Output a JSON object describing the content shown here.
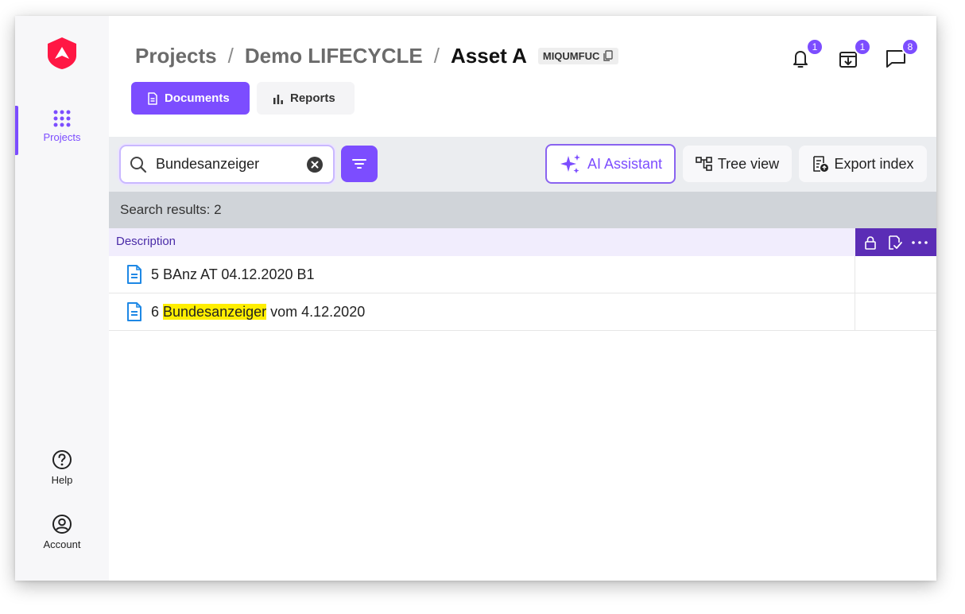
{
  "sidebar": {
    "items": [
      {
        "label": "Projects",
        "icon": "grid-icon",
        "active": true
      },
      {
        "label": "Help",
        "icon": "help-icon"
      },
      {
        "label": "Account",
        "icon": "account-icon"
      }
    ]
  },
  "breadcrumb": {
    "items": [
      "Projects",
      "Demo LIFECYCLE"
    ],
    "current": "Asset A",
    "separator": "/",
    "code": "MIQUMFUC"
  },
  "notifications": {
    "bell_count": "1",
    "inbox_count": "1",
    "chat_count": "8"
  },
  "tabs": [
    {
      "label": "Documents",
      "active": true
    },
    {
      "label": "Reports",
      "active": false
    }
  ],
  "toolbar": {
    "search_value": "Bundesanzeiger",
    "ai_label": "AI Assistant",
    "tree_label": "Tree view",
    "export_label": "Export index"
  },
  "results": {
    "summary": "Search results: 2"
  },
  "table": {
    "column_description": "Description",
    "rows": [
      {
        "text": "5 BAnz AT 04.12.2020 B1"
      },
      {
        "prefix": "6 ",
        "highlight": "Bundesanzeiger",
        "suffix": " vom 4.12.2020"
      }
    ]
  },
  "colors": {
    "accent": "#7c4dff",
    "header_dark": "#5b2db6",
    "highlight": "#ffee00",
    "logo": "#ff1744"
  }
}
